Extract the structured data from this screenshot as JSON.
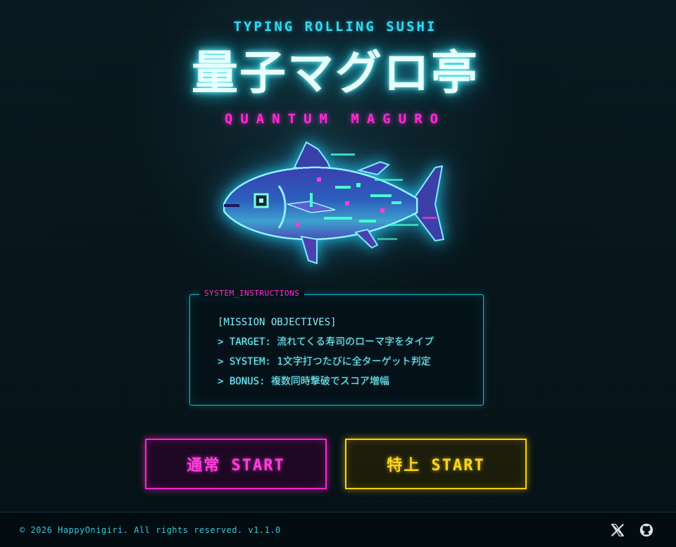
{
  "header": {
    "subtitle": "TYPING ROLLING SUSHI",
    "title_jp": "量子マグロ亭",
    "title_en": "QUANTUM MAGURO"
  },
  "hero": {
    "image": "quantum-tuna-pixel-art"
  },
  "instructions": {
    "tag": "SYSTEM_INSTRUCTIONS",
    "heading": "[MISSION OBJECTIVES]",
    "lines": [
      "> TARGET: 流れてくる寿司のローマ字をタイプ",
      "> SYSTEM: 1文字打つたびに全ターゲット判定",
      "> BONUS: 複数同時撃破でスコア増幅"
    ]
  },
  "buttons": {
    "normal_label": "通常 START",
    "special_label": "特上 START"
  },
  "footer": {
    "copyright": "© 2026 HappyOnigiri. All rights reserved. v1.1.0",
    "x_icon": "x-logo-icon",
    "github_icon": "github-icon"
  },
  "colors": {
    "cyan": "#35d9f2",
    "magenta": "#ff2bd6",
    "yellow": "#ffcd12",
    "background": "#06131a"
  }
}
